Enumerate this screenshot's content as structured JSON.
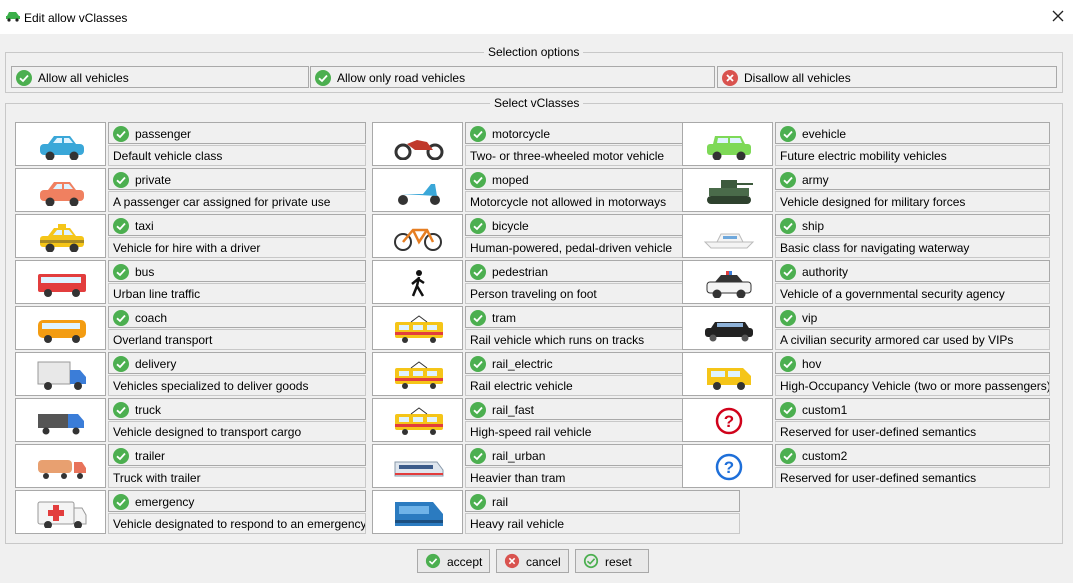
{
  "window": {
    "title": "Edit allow vClasses"
  },
  "selection": {
    "title": "Selection options",
    "allow_all": "Allow all vehicles",
    "allow_road": "Allow only road vehicles",
    "disallow_all": "Disallow all vehicles"
  },
  "classes_group": {
    "title": "Select vClasses"
  },
  "vclasses": [
    {
      "name": "passenger",
      "desc": "Default vehicle class",
      "icon": "car-icon",
      "checked": true
    },
    {
      "name": "private",
      "desc": "A passenger car assigned for private use",
      "icon": "car-icon",
      "checked": true
    },
    {
      "name": "taxi",
      "desc": "Vehicle for hire with a driver",
      "icon": "taxi-icon",
      "checked": true
    },
    {
      "name": "bus",
      "desc": "Urban line traffic",
      "icon": "bus-icon",
      "checked": true
    },
    {
      "name": "coach",
      "desc": "Overland transport",
      "icon": "coach-icon",
      "checked": true
    },
    {
      "name": "delivery",
      "desc": "Vehicles specialized to deliver goods",
      "icon": "delivery-truck-icon",
      "checked": true
    },
    {
      "name": "truck",
      "desc": "Vehicle designed to transport cargo",
      "icon": "truck-icon",
      "checked": true
    },
    {
      "name": "trailer",
      "desc": "Truck with trailer",
      "icon": "trailer-truck-icon",
      "checked": true
    },
    {
      "name": "emergency",
      "desc": "Vehicle designated to respond to an emergency",
      "icon": "ambulance-icon",
      "checked": true
    },
    {
      "name": "motorcycle",
      "desc": "Two- or three-wheeled motor vehicle",
      "icon": "motorcycle-icon",
      "checked": true
    },
    {
      "name": "moped",
      "desc": "Motorcycle not allowed in motorways",
      "icon": "moped-icon",
      "checked": true
    },
    {
      "name": "bicycle",
      "desc": "Human-powered, pedal-driven vehicle",
      "icon": "bicycle-icon",
      "checked": true
    },
    {
      "name": "pedestrian",
      "desc": "Person traveling on foot",
      "icon": "pedestrian-icon",
      "checked": true
    },
    {
      "name": "tram",
      "desc": "Rail vehicle which runs on tracks",
      "icon": "tram-icon",
      "checked": true
    },
    {
      "name": "rail_electric",
      "desc": "Rail electric vehicle",
      "icon": "tram-icon",
      "checked": true
    },
    {
      "name": "rail_fast",
      "desc": "High-speed rail vehicle",
      "icon": "tram-icon",
      "checked": true
    },
    {
      "name": "rail_urban",
      "desc": "Heavier than tram",
      "icon": "urban-train-icon",
      "checked": true
    },
    {
      "name": "rail",
      "desc": "Heavy rail vehicle",
      "icon": "rail-icon",
      "checked": true
    },
    {
      "name": "evehicle",
      "desc": "Future electric mobility vehicles",
      "icon": "electric-car-icon",
      "checked": true
    },
    {
      "name": "army",
      "desc": "Vehicle designed for military forces",
      "icon": "tank-icon",
      "checked": true
    },
    {
      "name": "ship",
      "desc": "Basic class for navigating waterway",
      "icon": "ship-icon",
      "checked": true
    },
    {
      "name": "authority",
      "desc": "Vehicle of a governmental security agency",
      "icon": "police-car-icon",
      "checked": true
    },
    {
      "name": "vip",
      "desc": "A civilian security armored car used by VIPs",
      "icon": "limousine-icon",
      "checked": true
    },
    {
      "name": "hov",
      "desc": "High-Occupancy Vehicle (two or more passengers)",
      "icon": "van-icon",
      "checked": true
    },
    {
      "name": "custom1",
      "desc": "Reserved for user-defined semantics",
      "icon": "question-red-icon",
      "checked": true
    },
    {
      "name": "custom2",
      "desc": "Reserved for user-defined semantics",
      "icon": "question-blue-icon",
      "checked": true
    }
  ],
  "buttons": {
    "accept": "accept",
    "cancel": "cancel",
    "reset": "reset"
  },
  "colors": {
    "check_green": "#4caf50",
    "cross_red": "#d9534f"
  }
}
